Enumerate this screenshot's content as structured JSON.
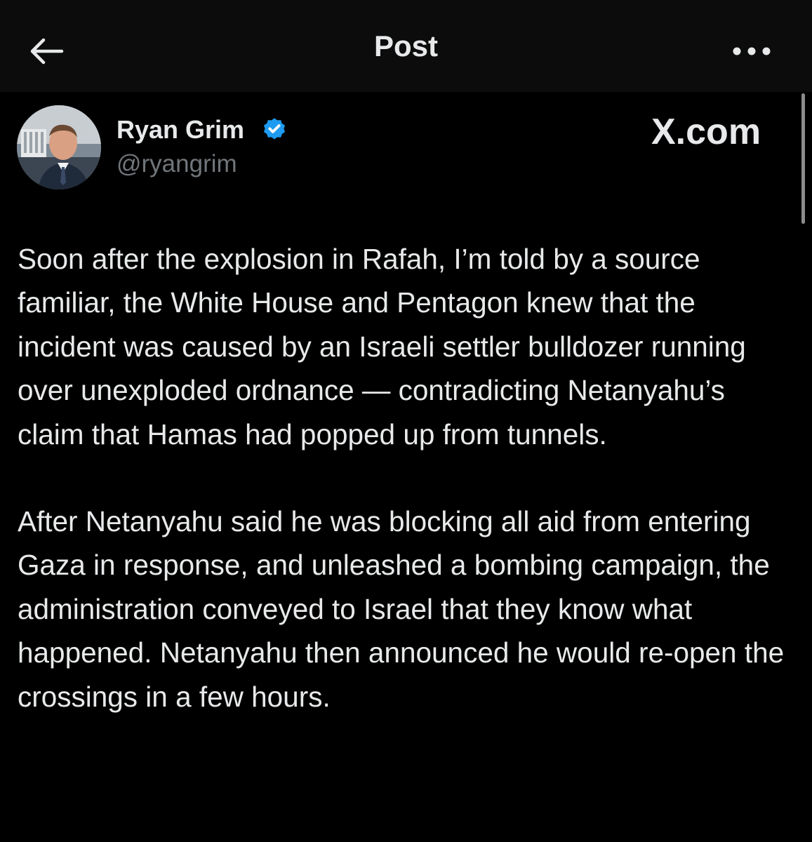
{
  "header": {
    "title": "Post"
  },
  "author": {
    "display_name": "Ryan Grim",
    "handle": "@ryangrim",
    "verified_icon": "verified-badge-icon",
    "verified_color": "#1d9bf0"
  },
  "watermark": "X.com",
  "post": {
    "paragraphs": [
      "Soon after the explosion in Rafah, I’m told by a source familiar, the White House and Pentagon knew that the incident was caused by an Israeli settler bulldozer running over unexploded ordnance — contradicting Netanyahu’s claim that Hamas had popped up from tunnels.",
      "After Netanyahu said he was blocking all aid from entering Gaza in response, and unleashed a bombing campaign, the administration conveyed to Israel that they know what happened. Netanyahu then announced he would re-open the crossings in a few hours."
    ]
  },
  "icons": {
    "back": "arrow-left-icon",
    "more": "more-horizontal-icon"
  }
}
